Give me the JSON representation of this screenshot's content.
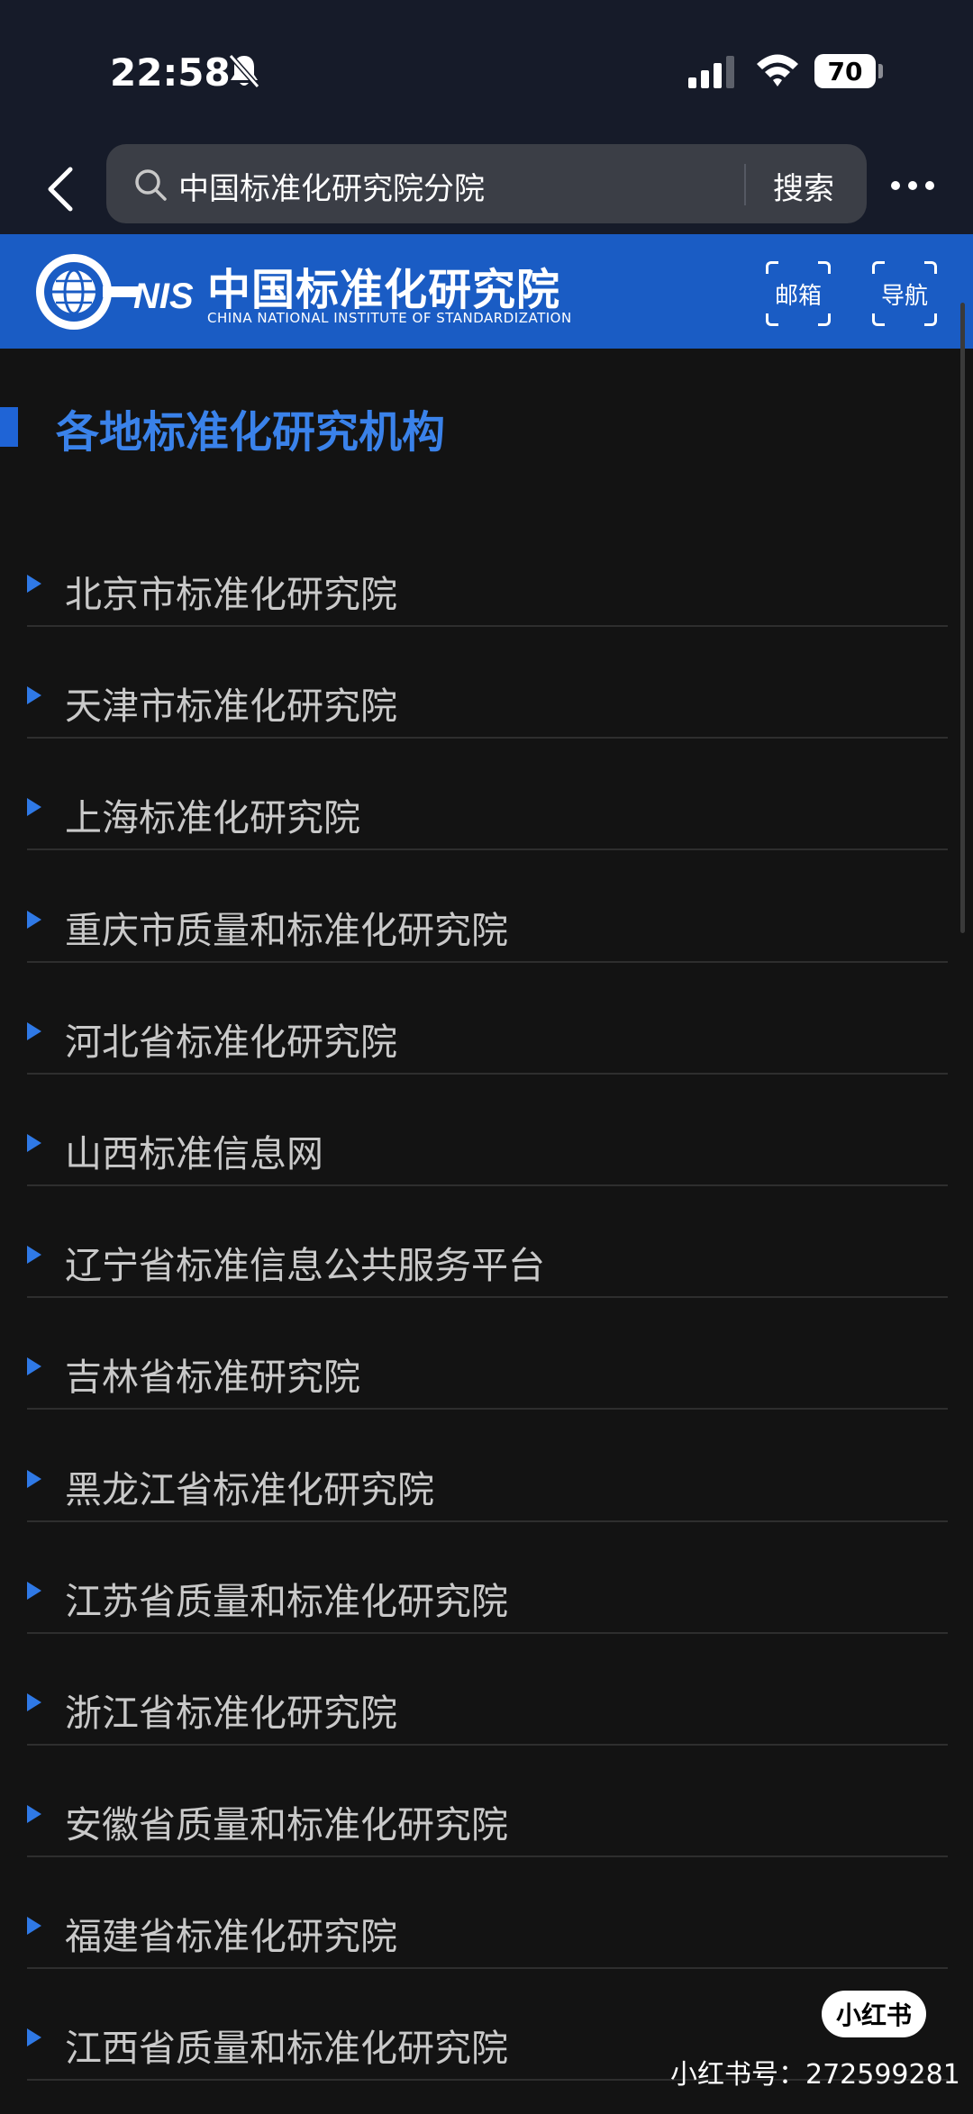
{
  "status_bar": {
    "time": "22:58",
    "battery": "70"
  },
  "browser": {
    "search_query": "中国标准化研究院分院",
    "search_button": "搜索"
  },
  "site_header": {
    "logo_short": "NIS",
    "logo_cn": "中国标准化研究院",
    "logo_en": "CHINA NATIONAL INSTITUTE OF STANDARDIZATION",
    "mail_button": "邮箱",
    "nav_button": "导航",
    "brand_color": "#1a5cc4"
  },
  "content": {
    "section_title": "各地标准化研究机构",
    "accent_color": "#3a82ea",
    "items": [
      "北京市标准化研究院",
      "天津市标准化研究院",
      "上海标准化研究院",
      "重庆市质量和标准化研究院",
      "河北省标准化研究院",
      "山西标准信息网",
      "辽宁省标准信息公共服务平台",
      "吉林省标准研究院",
      "黑龙江省标准化研究院",
      "江苏省质量和标准化研究院",
      "浙江省标准化研究院",
      "安徽省质量和标准化研究院",
      "福建省标准化研究院",
      "江西省质量和标准化研究院"
    ]
  },
  "watermark": {
    "logo": "小红书",
    "id_text": "小红书号：272599281"
  }
}
